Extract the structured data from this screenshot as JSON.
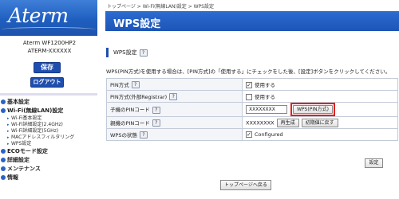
{
  "sidebar": {
    "logo": "Aterm",
    "model": "Aterm WF1200HP2",
    "ssid": "ATERM-XXXXXX",
    "save_label": "保存",
    "logout_label": "ログアウト",
    "menu": [
      {
        "label": "基本設定"
      },
      {
        "label": "Wi-Fi(無線LAN)設定",
        "sub": [
          "Wi-Fi基本設定",
          "Wi-Fi詳細設定(2.4GHz)",
          "Wi-Fi詳細設定(5GHz)",
          "MACアドレスフィルタリング",
          "WPS設定"
        ]
      },
      {
        "label": "ECOモード設定"
      },
      {
        "label": "詳細設定"
      },
      {
        "label": "メンテナンス"
      },
      {
        "label": "情報"
      }
    ]
  },
  "breadcrumb": "トップページ > Wi-Fi(無線LAN)設定 > WPS設定",
  "page_title": "WPS設定",
  "section_title": "WPS設定",
  "description": "WPS(PIN方式)を使用する場合は、[PIN方式]の「使用する」にチェックをした後、[設定]ボタンをクリックしてください。",
  "form": {
    "rows": [
      {
        "label": "PIN方式",
        "value": "使用する",
        "checked": true
      },
      {
        "label": "PIN方式(外部Registrar)",
        "value": "使用する",
        "checked": false
      },
      {
        "label": "子機のPINコード",
        "pin_value": "XXXXXXXX",
        "button": "WPS(PIN方式)"
      },
      {
        "label": "親機のPINコード",
        "value": "XXXXXXXX",
        "btn1": "再生成",
        "btn2": "初期値に戻す"
      },
      {
        "label": "WPSの状態",
        "value": "Configured",
        "checked": true
      }
    ],
    "help_label": "?"
  },
  "set_label": "設定",
  "back_label": "トップページへ戻る",
  "colors": {
    "header_blue": "#1d55b6",
    "highlight": "#e02020"
  }
}
